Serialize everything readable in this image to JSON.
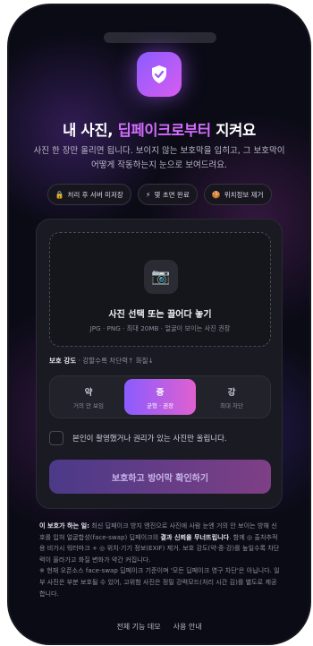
{
  "header": {
    "title_prefix": "내 사진, ",
    "title_accent": "딥페이크로부터",
    "title_suffix": " 지켜요",
    "subtitle": "사진 한 장만 올리면 됩니다. 보이지 않는 보호막을 입히고, 그 보호막이 어떻게 작동하는지 눈으로 보여드려요."
  },
  "chips": [
    {
      "icon": "🔒",
      "icon_name": "lock-icon",
      "label": "처리 후 서버 미저장"
    },
    {
      "icon": "⚡",
      "icon_name": "lightning-icon",
      "label": "몇 초면 완료"
    },
    {
      "icon": "🍪",
      "icon_name": "location-off-icon",
      "label": "위치정보 제거"
    }
  ],
  "upload": {
    "icon": "📷",
    "title": "사진 선택 또는 끌어다 놓기",
    "hint": "JPG · PNG · 최대 20MB · 얼굴이 보이는 사진 권장"
  },
  "strength": {
    "label": "보호 강도",
    "hint": " · 강할수록 차단력↑ 화질↓",
    "options": [
      {
        "title": "약",
        "sub": "거의 안 보임",
        "active": false
      },
      {
        "title": "중",
        "sub": "균형 · 권장",
        "active": true
      },
      {
        "title": "강",
        "sub": "최대 차단",
        "active": false
      }
    ]
  },
  "consent": {
    "label": "본인이 촬영했거나 권리가 있는 사진만 올립니다.",
    "checked": false
  },
  "submit_label": "보호하고 방어막 확인하기",
  "info": {
    "lead": "이 보호가 하는 일:",
    "body1": " 최신 딥페이크 방지 엔진으로 사진에 사람 눈엔 거의 안 보이는 방해 신호를 입혀 얼굴합성(face-swap) 딥페이크의 ",
    "bold1": "결과 신뢰을 무너뜨립니다",
    "body2": ". 함께 ◎ 출처추적용 비가시 워터마크 + ◎ 위치·기기 정보(EXIF) 제거. 보호 강도(약·중·강)를 높일수록 차단력이 올라가고 화질 변화가 약간 커집니다.",
    "note": "※ 현재 오픈소스 face-swap 딥페이크 기준이며 '모든 딥페이크 영구 차단'은 아닙니다. 일부 사진은 부분 보호될 수 있어, 고위험 사진은 정밀 강력모드(처리 시간 김)를 별도로 제공합니다."
  },
  "footer": {
    "demo": "전체 기능 데모",
    "guide": "사용 안내"
  },
  "colors": {
    "background": "#0b0b16",
    "accent": "#d46cff",
    "gradient_start": "#8a5cff",
    "gradient_end": "#e060d0"
  }
}
